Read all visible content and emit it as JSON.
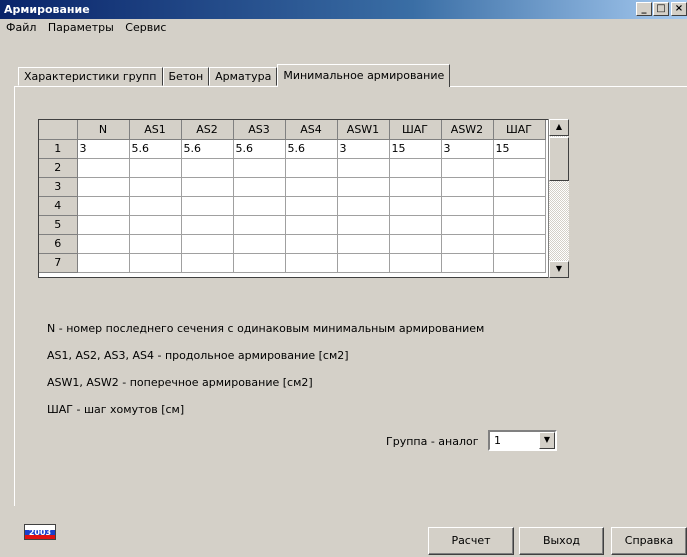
{
  "window": {
    "title": "Армирование",
    "controls": [
      "_",
      "□",
      "×"
    ]
  },
  "menu": [
    "Файл",
    "Параметры",
    "Сервис"
  ],
  "tabs": [
    "Характеристики групп",
    "Бетон",
    "Арматура",
    "Минимальное армирование"
  ],
  "active_tab": 3,
  "grid": {
    "columns": [
      "",
      "N",
      "AS1",
      "AS2",
      "AS3",
      "AS4",
      "ASW1",
      "ШАГ",
      "ASW2",
      "ШАГ"
    ],
    "rows": [
      [
        "1",
        "3",
        "5.6",
        "5.6",
        "5.6",
        "5.6",
        "3",
        "15",
        "3",
        "15"
      ],
      [
        "2",
        "",
        "",
        "",
        "",
        "",
        "",
        "",
        "",
        ""
      ],
      [
        "3",
        "",
        "",
        "",
        "",
        "",
        "",
        "",
        "",
        ""
      ],
      [
        "4",
        "",
        "",
        "",
        "",
        "",
        "",
        "",
        "",
        ""
      ],
      [
        "5",
        "",
        "",
        "",
        "",
        "",
        "",
        "",
        "",
        ""
      ],
      [
        "6",
        "",
        "",
        "",
        "",
        "",
        "",
        "",
        "",
        ""
      ],
      [
        "7",
        "",
        "",
        "",
        "",
        "",
        "",
        "",
        "",
        ""
      ]
    ]
  },
  "info": [
    "N - номер  последнего сечения с одинаковым минимальным армированием",
    "AS1, AS2, AS3, AS4 - продольное армирование  [см2]",
    "ASW1, ASW2 - поперечное армирование  [см2]",
    "ШАГ - шаг хомутов [см]"
  ],
  "analog": {
    "label": "Группа - аналог",
    "value": "1"
  },
  "logo_text": "2003",
  "buttons": {
    "calc": "Расчет",
    "exit": "Выход",
    "help": "Справка"
  }
}
